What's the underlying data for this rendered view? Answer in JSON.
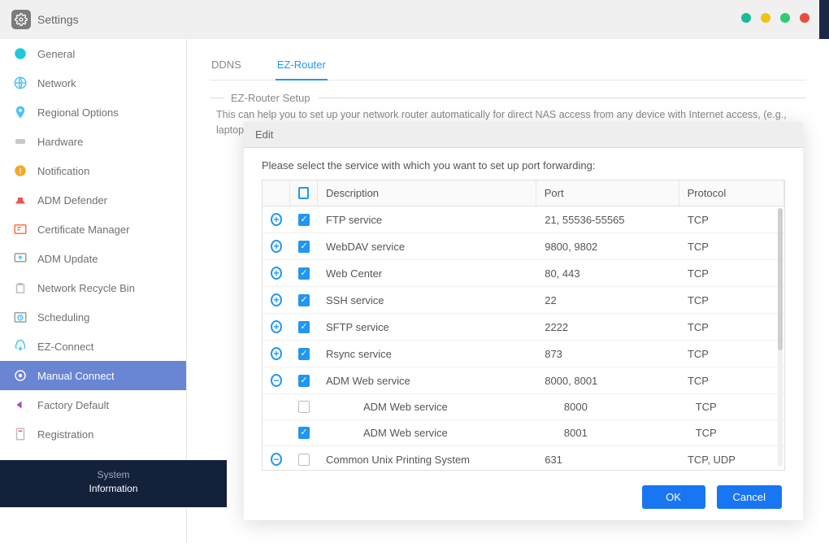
{
  "window": {
    "title": "Settings"
  },
  "sidebar": {
    "items": [
      {
        "label": "General"
      },
      {
        "label": "Network"
      },
      {
        "label": "Regional Options"
      },
      {
        "label": "Hardware"
      },
      {
        "label": "Notification"
      },
      {
        "label": "ADM Defender"
      },
      {
        "label": "Certificate Manager"
      },
      {
        "label": "ADM Update"
      },
      {
        "label": "Network Recycle Bin"
      },
      {
        "label": "Scheduling"
      },
      {
        "label": "EZ-Connect"
      },
      {
        "label": "Manual Connect"
      },
      {
        "label": "Factory Default"
      },
      {
        "label": "Registration"
      }
    ],
    "sysinfo_line1": "System",
    "sysinfo_line2": "Information"
  },
  "tabs": {
    "ddns": "DDNS",
    "ezrouter": "EZ-Router"
  },
  "section": {
    "title": "EZ-Router Setup",
    "desc": "This can help you to set up your network router automatically for direct NAS access from any device with Internet access, (e.g., laptop and mobile phone)."
  },
  "modal": {
    "title": "Edit",
    "message": "Please select the service with which you want to set up port forwarding:",
    "columns": {
      "desc": "Description",
      "port": "Port",
      "proto": "Protocol"
    },
    "rows": [
      {
        "lvl": 0,
        "exp": "plus",
        "chk": true,
        "desc": "FTP service",
        "port": "21, 55536-55565",
        "proto": "TCP"
      },
      {
        "lvl": 0,
        "exp": "plus",
        "chk": true,
        "desc": "WebDAV service",
        "port": "9800, 9802",
        "proto": "TCP"
      },
      {
        "lvl": 0,
        "exp": "plus",
        "chk": true,
        "desc": "Web Center",
        "port": "80, 443",
        "proto": "TCP"
      },
      {
        "lvl": 0,
        "exp": "plus",
        "chk": true,
        "desc": "SSH service",
        "port": "22",
        "proto": "TCP"
      },
      {
        "lvl": 0,
        "exp": "plus",
        "chk": true,
        "desc": "SFTP service",
        "port": "2222",
        "proto": "TCP"
      },
      {
        "lvl": 0,
        "exp": "plus",
        "chk": true,
        "desc": "Rsync service",
        "port": "873",
        "proto": "TCP"
      },
      {
        "lvl": 0,
        "exp": "minus",
        "chk": true,
        "desc": "ADM Web service",
        "port": "8000, 8001",
        "proto": "TCP"
      },
      {
        "lvl": 1,
        "exp": "",
        "chk": false,
        "desc": "ADM Web service",
        "port": "8000",
        "proto": "TCP"
      },
      {
        "lvl": 1,
        "exp": "",
        "chk": true,
        "desc": "ADM Web service",
        "port": "8001",
        "proto": "TCP"
      },
      {
        "lvl": 0,
        "exp": "minus",
        "chk": false,
        "desc": "Common Unix Printing System",
        "port": "631",
        "proto": "TCP, UDP"
      }
    ],
    "ok": "OK",
    "cancel": "Cancel"
  }
}
